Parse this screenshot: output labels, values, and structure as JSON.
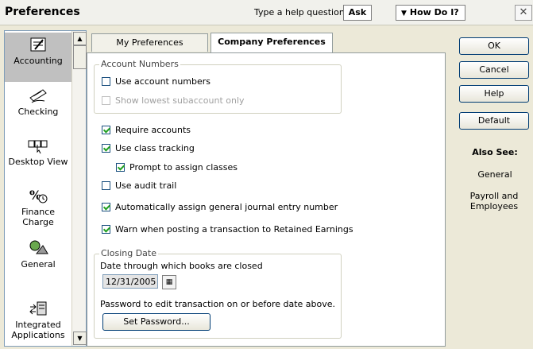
{
  "window": {
    "title": "Preferences",
    "help_prompt": "Type a help question",
    "ask_label": "Ask",
    "howdo_label": "How Do I?",
    "close_glyph": "✕"
  },
  "sidebar": {
    "items": [
      {
        "label": "Accounting",
        "icon": "accounting-icon",
        "selected": true
      },
      {
        "label": "Checking",
        "icon": "checking-icon"
      },
      {
        "label": "Desktop View",
        "icon": "desktop-view-icon"
      },
      {
        "label": "Finance Charge",
        "icon": "finance-charge-icon"
      },
      {
        "label": "General",
        "icon": "general-icon"
      },
      {
        "label": "Integrated Applications",
        "icon": "integrated-applications-icon"
      }
    ]
  },
  "tabs": [
    {
      "label": "My Preferences",
      "active": false
    },
    {
      "label": "Company Preferences",
      "active": true
    }
  ],
  "account_numbers": {
    "legend": "Account Numbers",
    "use_account_numbers": {
      "label": "Use account numbers",
      "checked": false
    },
    "show_lowest": {
      "label": "Show lowest subaccount only",
      "checked": false,
      "disabled": true
    }
  },
  "options": {
    "require_accounts": {
      "label": "Require accounts",
      "checked": true
    },
    "use_class_tracking": {
      "label": "Use class tracking",
      "checked": true
    },
    "prompt_assign_classes": {
      "label": "Prompt to assign classes",
      "checked": true
    },
    "use_audit_trail": {
      "label": "Use audit trail",
      "checked": false
    },
    "auto_journal": {
      "label": "Automatically assign general journal entry number",
      "checked": true
    },
    "warn_retained": {
      "label": "Warn when posting a transaction to Retained Earnings",
      "checked": true
    }
  },
  "closing_date": {
    "legend": "Closing Date",
    "date_label": "Date through which books are closed",
    "date_value": "12/31/2005",
    "password_label": "Password to edit transaction on or before date above.",
    "set_password_label": "Set Password..."
  },
  "buttons": {
    "ok": "OK",
    "cancel": "Cancel",
    "help": "Help",
    "default": "Default"
  },
  "also_see": {
    "heading": "Also See:",
    "links": [
      "General",
      "Payroll and Employees"
    ]
  },
  "colors": {
    "checkmark": "#21a121",
    "selection": "#c0c0c0"
  }
}
